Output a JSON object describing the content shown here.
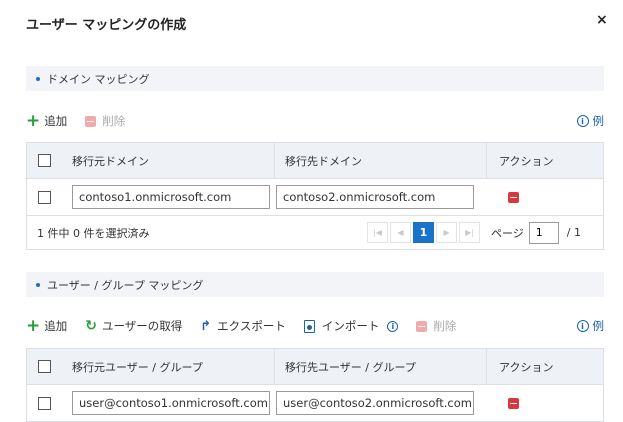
{
  "dialog": {
    "title": "ユーザー マッピングの作成",
    "close": "×"
  },
  "domain_section": {
    "header": "ドメイン マッピング",
    "toolbar": {
      "add": "追加",
      "delete": "削除",
      "example": "例"
    },
    "columns": {
      "source": "移行元ドメイン",
      "target": "移行先ドメイン",
      "action": "アクション"
    },
    "rows": [
      {
        "source": "contoso1.onmicrosoft.com",
        "target": "contoso2.onmicrosoft.com"
      }
    ],
    "pager": {
      "selected": "1 件中 0 件を選択済み",
      "current_page": "1",
      "page_label": "ページ",
      "page_input": "1",
      "total": "/ 1"
    }
  },
  "user_section": {
    "header": "ユーザー / グループ マッピング",
    "toolbar": {
      "add": "追加",
      "retrieve": "ユーザーの取得",
      "export": "エクスポート",
      "import": "インポート",
      "delete": "削除",
      "example": "例"
    },
    "columns": {
      "source": "移行元ユーザー / グループ",
      "target": "移行先ユーザー / グループ",
      "action": "アクション"
    },
    "rows": [
      {
        "source": "user@contoso1.onmicrosoft.com",
        "target": "user@contoso2.onmicrosoft.com"
      }
    ]
  },
  "icons": {
    "add": "plus-icon",
    "delete": "minus-icon",
    "info": "info-icon",
    "refresh": "refresh-icon",
    "export": "share-arrow-icon",
    "import": "import-file-icon"
  },
  "colors": {
    "accent": "#1a73c8",
    "add_green": "#2a9d3c",
    "delete_red": "#d9363e",
    "header_bg": "#f2f4f7"
  }
}
